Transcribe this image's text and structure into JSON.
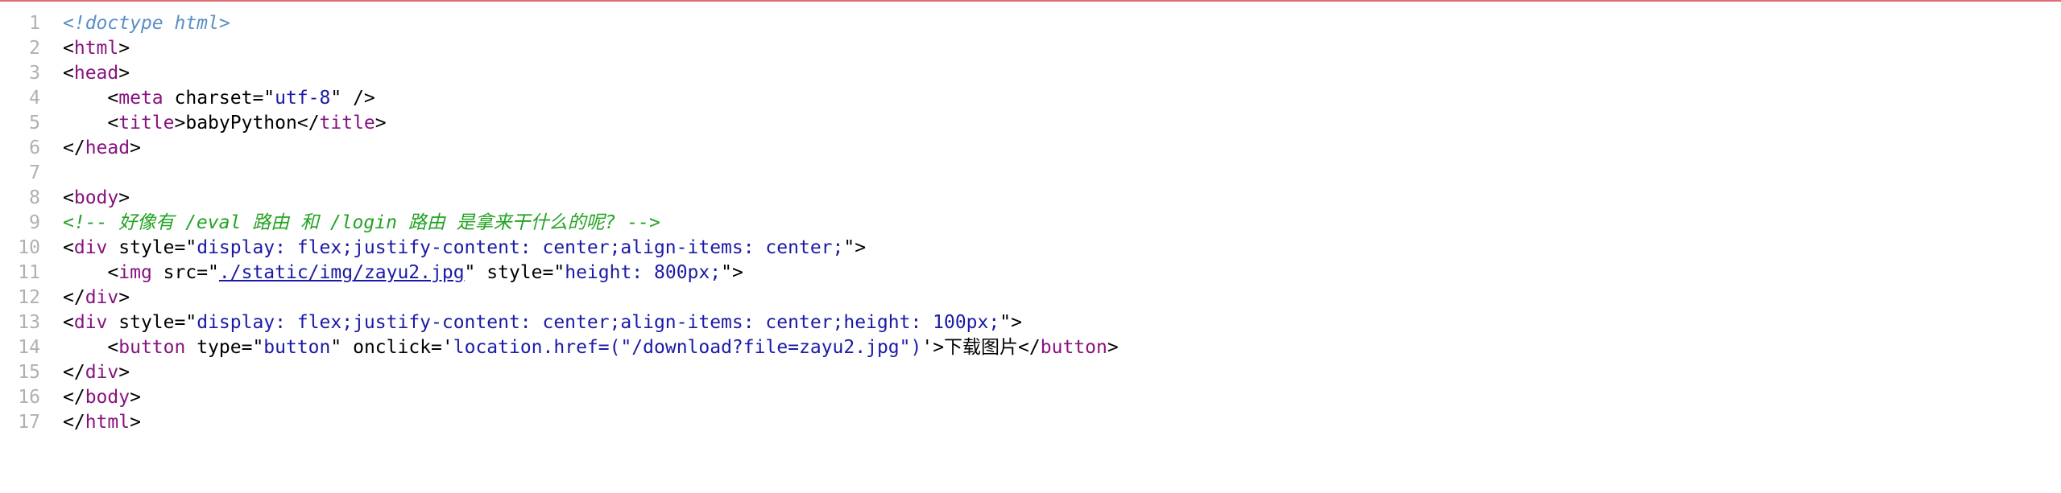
{
  "colors": {
    "top_rule": "#e06c75",
    "line_number": "#b0b0b0",
    "tag": "#881280",
    "attribute_value": "#1a1aa6",
    "comment": "#22a322",
    "doctype": "#5a8fc6"
  },
  "source": {
    "line_numbers": [
      "1",
      "2",
      "3",
      "4",
      "5",
      "6",
      "7",
      "8",
      "9",
      "10",
      "11",
      "12",
      "13",
      "14",
      "15",
      "16",
      "17"
    ],
    "doctype": "<!doctype html>",
    "comment": "<!-- 好像有 /eval 路由 和 /login 路由 是拿来干什么的呢? -->",
    "title_text": "babyPython",
    "meta_charset_value": "utf-8",
    "div1_style": "display: flex;justify-content: center;align-items: center;",
    "img_src": "./static/img/zayu2.jpg",
    "img_style": "height: 800px;",
    "div2_style": "display: flex;justify-content: center;align-items: center;height: 100px;",
    "button_type": "button",
    "button_onclick": "location.href=(\"/download?file=zayu2.jpg\")",
    "button_text": "下载图片"
  }
}
